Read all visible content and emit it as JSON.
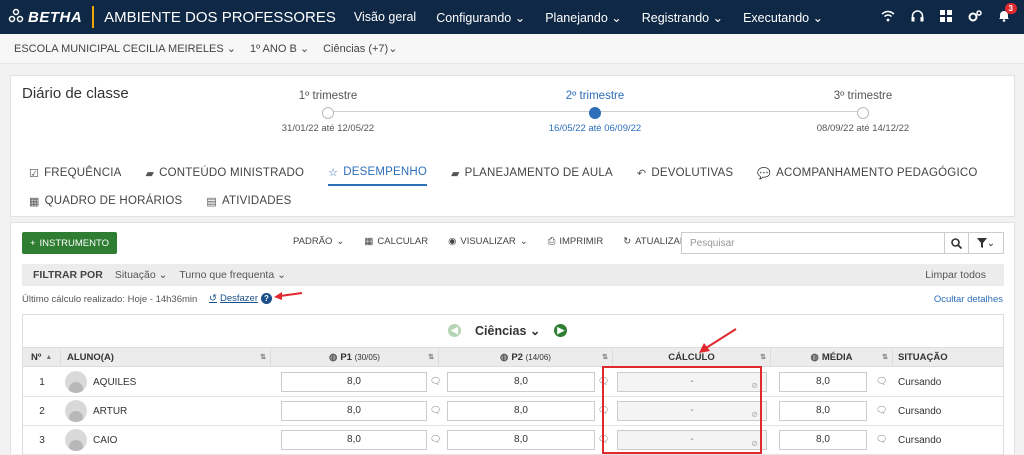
{
  "topbar": {
    "logo": "BETHA",
    "app_title": "AMBIENTE DOS PROFESSORES",
    "nav": [
      "Visão geral",
      "Configurando ⌄",
      "Planejando ⌄",
      "Registrando ⌄",
      "Executando ⌄"
    ],
    "notifications_count": "3"
  },
  "breadcrumb": {
    "school": "ESCOLA MUNICIPAL CECILIA MEIRELES",
    "class": "1º ANO B",
    "subject": "Ciências (+7)"
  },
  "diary": {
    "title": "Diário de classe",
    "terms": [
      {
        "label": "1º trimestre",
        "dates": "31/01/22 até 12/05/22"
      },
      {
        "label": "2º trimestre",
        "dates": "16/05/22 até 06/09/22"
      },
      {
        "label": "3º trimestre",
        "dates": "08/09/22 até 14/12/22"
      }
    ],
    "tabs": [
      "FREQUÊNCIA",
      "CONTEÚDO MINISTRADO",
      "DESEMPENHO",
      "PLANEJAMENTO DE AULA",
      "DEVOLUTIVAS",
      "ACOMPANHAMENTO PEDAGÓGICO",
      "QUADRO DE HORÁRIOS",
      "ATIVIDADES"
    ]
  },
  "toolbar": {
    "instrument_button": "INSTRUMENTO",
    "standard": "PADRÃO",
    "calculate": "CALCULAR",
    "view": "VISUALIZAR",
    "print": "IMPRIMIR",
    "refresh": "ATUALIZAR",
    "search_placeholder": "Pesquisar"
  },
  "filters": {
    "label": "FILTRAR POR",
    "status": "Situação",
    "shift": "Turno que frequenta",
    "clear": "Limpar todos"
  },
  "calc": {
    "info": "Último cálculo realizado: Hoje - 14h36min",
    "undo": "Desfazer",
    "hide_details": "Ocultar detalhes"
  },
  "grid": {
    "subject": "Ciências",
    "headers": {
      "number": "Nº",
      "student": "ALUNO(A)",
      "p1": "P1",
      "p1_date": "(30/05)",
      "p2": "P2",
      "p2_date": "(14/06)",
      "calc": "CÁLCULO",
      "average": "MÉDIA",
      "status": "SITUAÇÃO"
    },
    "rows": [
      {
        "num": "1",
        "name": "AQUILES",
        "p1": "8,0",
        "p2": "8,0",
        "calc": "-",
        "avg": "8,0",
        "status": "Cursando"
      },
      {
        "num": "2",
        "name": "ARTUR",
        "p1": "8,0",
        "p2": "8,0",
        "calc": "-",
        "avg": "8,0",
        "status": "Cursando"
      },
      {
        "num": "3",
        "name": "CAIO",
        "p1": "8,0",
        "p2": "8,0",
        "calc": "-",
        "avg": "8,0",
        "status": "Cursando"
      }
    ]
  },
  "colors": {
    "topbar": "#0f2846",
    "accent": "#2d6fb8",
    "green": "#2e7d32",
    "highlight": "#e0282f"
  }
}
